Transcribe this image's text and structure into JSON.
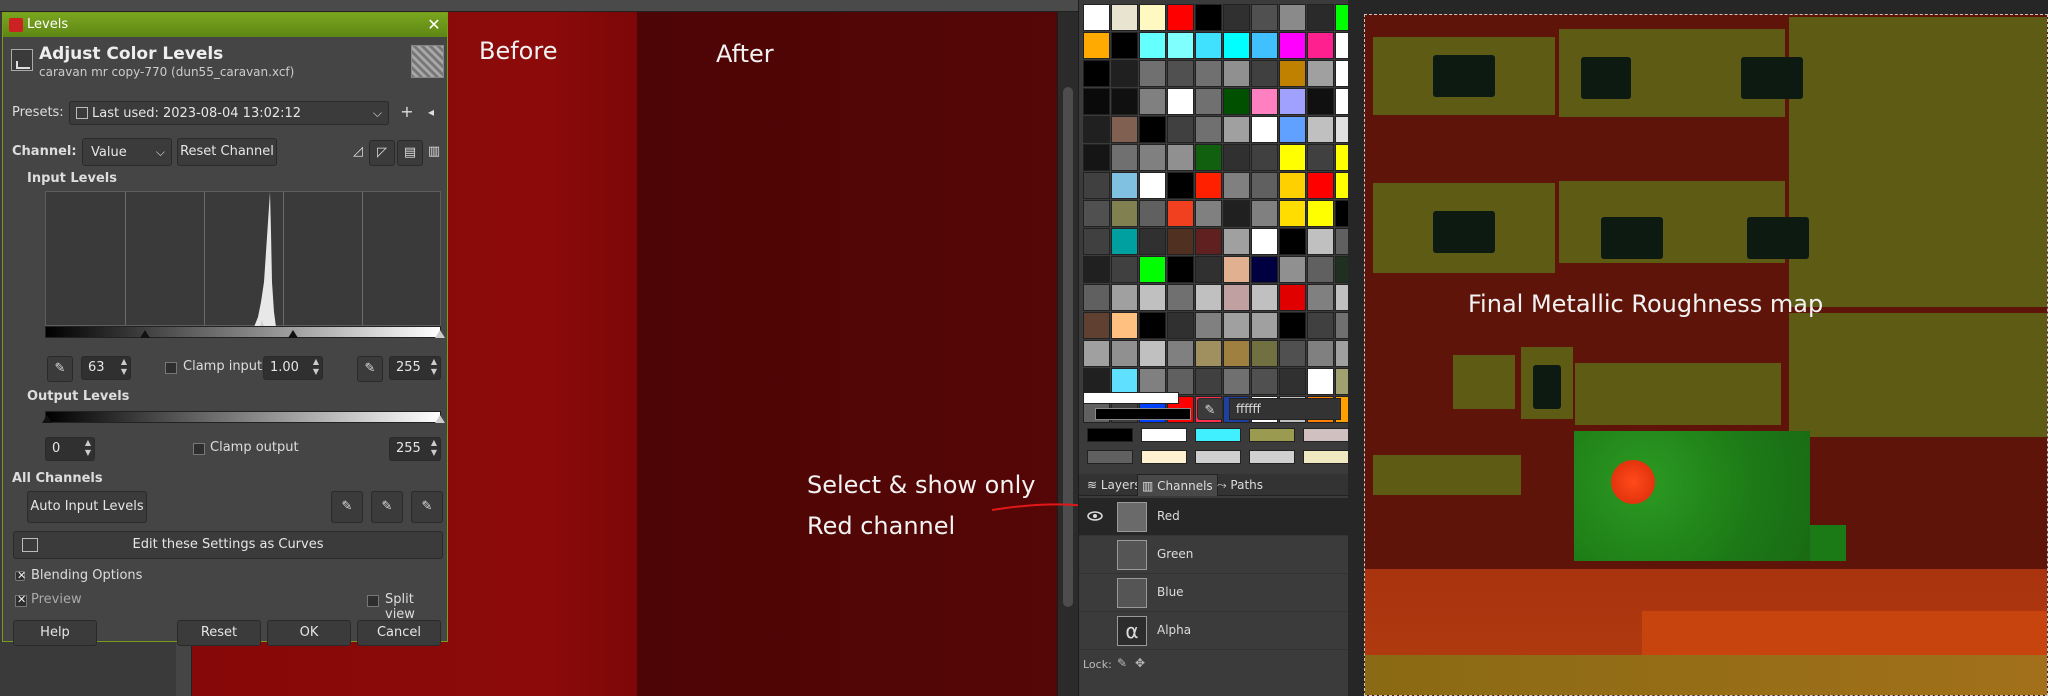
{
  "dialog": {
    "window_title": "Levels",
    "header_title": "Adjust Color Levels",
    "header_subtitle": "caravan mr copy-770 (dun55_caravan.xcf)",
    "presets_label": "Presets:",
    "presets_value": "Last used: 2023-08-04 13:02:12",
    "channel_label": "Channel:",
    "channel_value": "Value",
    "reset_channel": "Reset Channel",
    "input_levels_label": "Input Levels",
    "input_low": "63",
    "gamma": "1.00",
    "input_high": "255",
    "clamp_input": "Clamp input",
    "output_levels_label": "Output Levels",
    "output_low": "0",
    "output_high": "255",
    "clamp_output": "Clamp output",
    "all_channels_label": "All Channels",
    "auto_input_levels": "Auto Input Levels",
    "edit_as_curves": "Edit these Settings as Curves",
    "blending_options": "Blending Options",
    "preview": "Preview",
    "split_view": "Split view",
    "help": "Help",
    "reset": "Reset",
    "ok": "OK",
    "cancel": "Cancel",
    "preview_checked": true,
    "split_view_checked": false
  },
  "canvas": {
    "before_label": "Before",
    "after_label": "After",
    "note_line1": "Select & show only",
    "note_line2": "Red channel",
    "before_color": "#870808",
    "after_color": "#510606"
  },
  "dock": {
    "hex_value": "ffffff",
    "tabs": [
      "Layers",
      "Channels",
      "Paths"
    ],
    "channels": [
      "Red",
      "Green",
      "Blue",
      "Alpha"
    ],
    "lock_label": "Lock:",
    "palette": [
      "#ffffff",
      "#e8e4d0",
      "#fff8c0",
      "#ff0000",
      "#000000",
      "#303030",
      "#505050",
      "#8a8a8a",
      "#2a2a2a",
      "#00ff00",
      "#ffaa00",
      "#000000",
      "#66ffff",
      "#80ffff",
      "#40e0ff",
      "#00ffff",
      "#40c0ff",
      "#ff00ff",
      "#ff2090",
      "#ffffff",
      "#000000",
      "#202020",
      "#707070",
      "#505050",
      "#707070",
      "#909090",
      "#404040",
      "#c08000",
      "#a0a0a0",
      "#ffffff",
      "#0a0a0a",
      "#101010",
      "#808080",
      "#ffffff",
      "#707070",
      "#005000",
      "#ff80c0",
      "#a0a0ff",
      "#101010",
      "#ffffff",
      "#202020",
      "#806050",
      "#000000",
      "#404040",
      "#707070",
      "#a0a0a0",
      "#ffffff",
      "#60a0ff",
      "#c0c0c0",
      "#e0e0e0",
      "#151515",
      "#707070",
      "#808080",
      "#909090",
      "#106010",
      "#303030",
      "#404040",
      "#ffff00",
      "#404040",
      "#ffff00",
      "#404040",
      "#80c0e0",
      "#ffffff",
      "#000000",
      "#ff2000",
      "#808080",
      "#606060",
      "#ffd000",
      "#ff0000",
      "#ffff00",
      "#505050",
      "#808050",
      "#606060",
      "#f04020",
      "#808080",
      "#202020",
      "#808080",
      "#ffdd00",
      "#ffff00",
      "#000000",
      "#404040",
      "#00a0a0",
      "#303030",
      "#503020",
      "#602020",
      "#a0a0a0",
      "#ffffff",
      "#000000",
      "#c0c0c0",
      "#606060",
      "#202020",
      "#404040",
      "#00ff00",
      "#000000",
      "#303030",
      "#e0b090",
      "#000040",
      "#909090",
      "#606060",
      "#203020",
      "#606060",
      "#a0a0a0",
      "#c0c0c0",
      "#707070",
      "#c0c0c0",
      "#c0a0a0",
      "#c0c0c0",
      "#e00000",
      "#808080",
      "#c0c0c0",
      "#604030",
      "#ffc080",
      "#000000",
      "#303030",
      "#808080",
      "#a0a0a0",
      "#a0a0a0",
      "#000000",
      "#404040",
      "#707070",
      "#a0a0a0",
      "#909090",
      "#c0c0c0",
      "#808080",
      "#a09060",
      "#a08040",
      "#707040",
      "#505050",
      "#808080",
      "#a0a0a0",
      "#202020",
      "#60e0ff",
      "#808080",
      "#606060",
      "#404040",
      "#707070",
      "#505050",
      "#303030",
      "#ffffff",
      "#a0a070",
      "#606060",
      "#404040",
      "#0040ff",
      "#ff0000",
      "#ff3050",
      "#2040a0",
      "#ffffff",
      "#c0c0c0",
      "#ff8000",
      "#ffa000"
    ],
    "recent_colors": [
      "#000000",
      "#ffffff",
      "#40f0ff",
      "#9a9a50",
      "#d0c0c0",
      "#606060",
      "#fff0d0",
      "#d0d0d0",
      "#d0d0d0",
      "#f0e8c0"
    ]
  },
  "texture": {
    "caption": "Final Metallic Roughness map"
  }
}
